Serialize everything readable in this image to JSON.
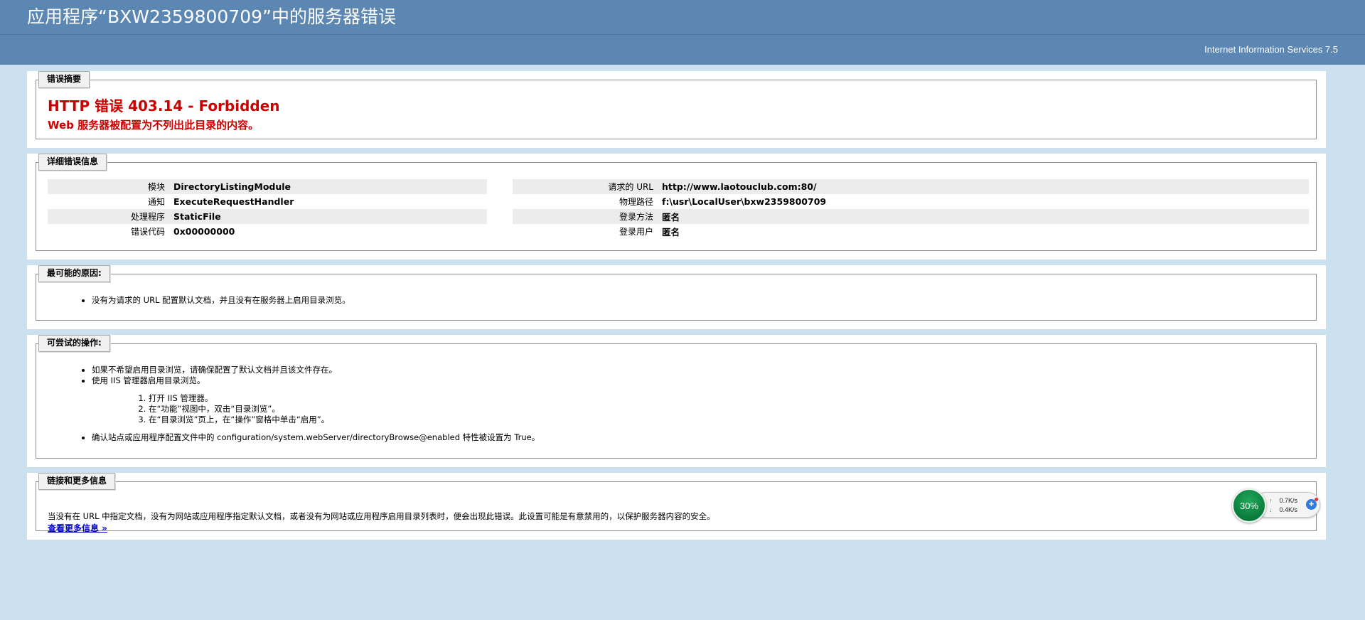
{
  "header": {
    "title": "应用程序“BXW2359800709”中的服务器错误",
    "product": "Internet Information Services 7.5"
  },
  "summary": {
    "legend": "错误摘要",
    "error_title": "HTTP 错误 403.14 - Forbidden",
    "error_desc": "Web 服务器被配置为不列出此目录的内容。"
  },
  "details": {
    "legend": "详细错误信息",
    "left": [
      {
        "label": "模块",
        "value": "DirectoryListingModule"
      },
      {
        "label": "通知",
        "value": "ExecuteRequestHandler"
      },
      {
        "label": "处理程序",
        "value": "StaticFile"
      },
      {
        "label": "错误代码",
        "value": "0x00000000"
      }
    ],
    "right": [
      {
        "label": "请求的 URL",
        "value": "http://www.laotouclub.com:80/"
      },
      {
        "label": "物理路径",
        "value": "f:\\usr\\LocalUser\\bxw2359800709"
      },
      {
        "label": "登录方法",
        "value": "匿名"
      },
      {
        "label": "登录用户",
        "value": "匿名"
      }
    ]
  },
  "causes": {
    "legend": "最可能的原因:",
    "items": [
      "没有为请求的 URL 配置默认文档，并且没有在服务器上启用目录浏览。"
    ]
  },
  "actions": {
    "legend": "可尝试的操作:",
    "item1": "如果不希望启用目录浏览，请确保配置了默认文档并且该文件存在。",
    "item2": "使用 IIS 管理器启用目录浏览。",
    "steps": [
      "打开 IIS 管理器。",
      "在“功能”视图中，双击“目录浏览”。",
      "在“目录浏览”页上，在“操作”窗格中单击“启用”。"
    ],
    "item3": "确认站点或应用程序配置文件中的 configuration/system.webServer/directoryBrowse@enabled 特性被设置为 True。"
  },
  "links": {
    "legend": "链接和更多信息",
    "text": "当没有在 URL 中指定文档，没有为网站或应用程序指定默认文档，或者没有为网站或应用程序启用目录列表时，便会出现此错误。此设置可能是有意禁用的，以保护服务器内容的安全。",
    "more": "查看更多信息 »"
  },
  "net_widget": {
    "percent": "30%",
    "up": "0.7K/s",
    "down": "0.4K/s",
    "plus": "+"
  },
  "colors": {
    "header_bg": "#5c87b2",
    "page_bg": "#cbe1ef",
    "error_red": "#cc0000",
    "link_blue": "#0000cc"
  }
}
